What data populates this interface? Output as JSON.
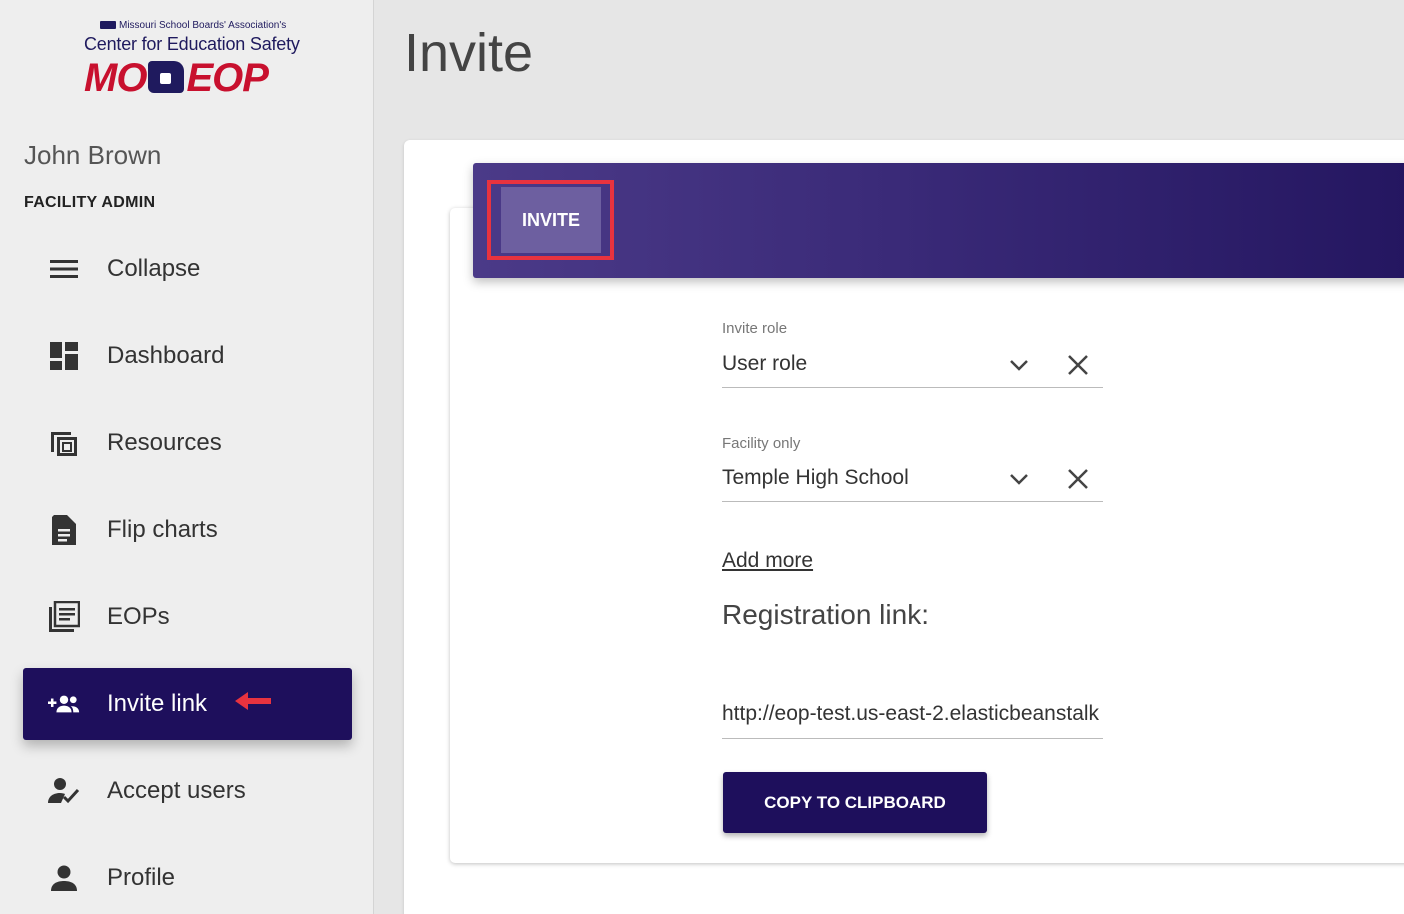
{
  "logo": {
    "top_text": "Missouri School Boards' Association's",
    "mid_text": "Center for Education Safety",
    "left_text": "MO",
    "right_text": "EOP"
  },
  "user": {
    "name": "John Brown",
    "role": "FACILITY ADMIN"
  },
  "nav": {
    "items": [
      {
        "label": "Collapse",
        "icon": "menu-icon"
      },
      {
        "label": "Dashboard",
        "icon": "dashboard-icon"
      },
      {
        "label": "Resources",
        "icon": "library-icon"
      },
      {
        "label": "Flip charts",
        "icon": "document-icon"
      },
      {
        "label": "EOPs",
        "icon": "list-document-icon"
      },
      {
        "label": "Invite link",
        "icon": "group-add-icon",
        "active": true
      },
      {
        "label": "Accept users",
        "icon": "user-check-icon"
      },
      {
        "label": "Profile",
        "icon": "person-icon"
      }
    ]
  },
  "page": {
    "title": "Invite"
  },
  "card": {
    "tab_label": "INVITE",
    "role_field": {
      "label": "Invite role",
      "value": "User role"
    },
    "facility_field": {
      "label": "Facility only",
      "value": "Temple High School"
    },
    "add_more": "Add more",
    "registration_title": "Registration link:",
    "registration_link": "http://eop-test.us-east-2.elasticbeanstalk",
    "copy_button": "COPY TO CLIPBOARD"
  },
  "colors": {
    "primary": "#1e0f5c",
    "accent_red": "#e8333f",
    "logo_red": "#c8102e"
  }
}
